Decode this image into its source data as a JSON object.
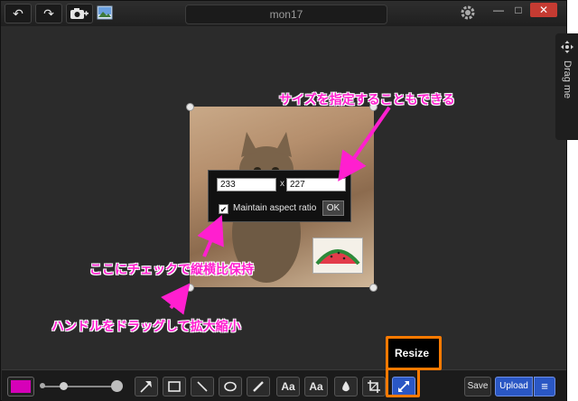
{
  "window": {
    "title": "mon17",
    "controls": {
      "minimize": "—",
      "maximize": "□",
      "close": "✕"
    }
  },
  "titlebar": {
    "buttons": [
      {
        "icon": "undo-icon",
        "glyph": "↶"
      },
      {
        "icon": "redo-icon",
        "glyph": "↷"
      },
      {
        "icon": "camera-add-icon",
        "glyph": ""
      },
      {
        "icon": "image-icon",
        "glyph": ""
      }
    ]
  },
  "side_tab": {
    "label": "Drag me"
  },
  "resize_dialog": {
    "width_value": "233",
    "separator": "x",
    "height_value": "227",
    "aspect_label": "Maintain aspect ratio",
    "aspect_checked": "✔",
    "ok_label": "OK"
  },
  "annotations": {
    "size_note": "サイズを指定することもできる",
    "checkbox_note": "ここにチェックで縦横比保持",
    "handle_note": "ハンドルをドラッグして拡大縮小"
  },
  "toolbar": {
    "accent_color": "#d600b8",
    "text_tool_1": "Aa",
    "text_tool_2": "Aa",
    "resize_tooltip": "Resize",
    "save_label": "Save",
    "upload_label": "Upload",
    "menu_glyph": "≡"
  },
  "colors": {
    "highlight": "#ff7a00",
    "annotation": "#ff1fcf",
    "active_tool": "#2a57c4"
  }
}
